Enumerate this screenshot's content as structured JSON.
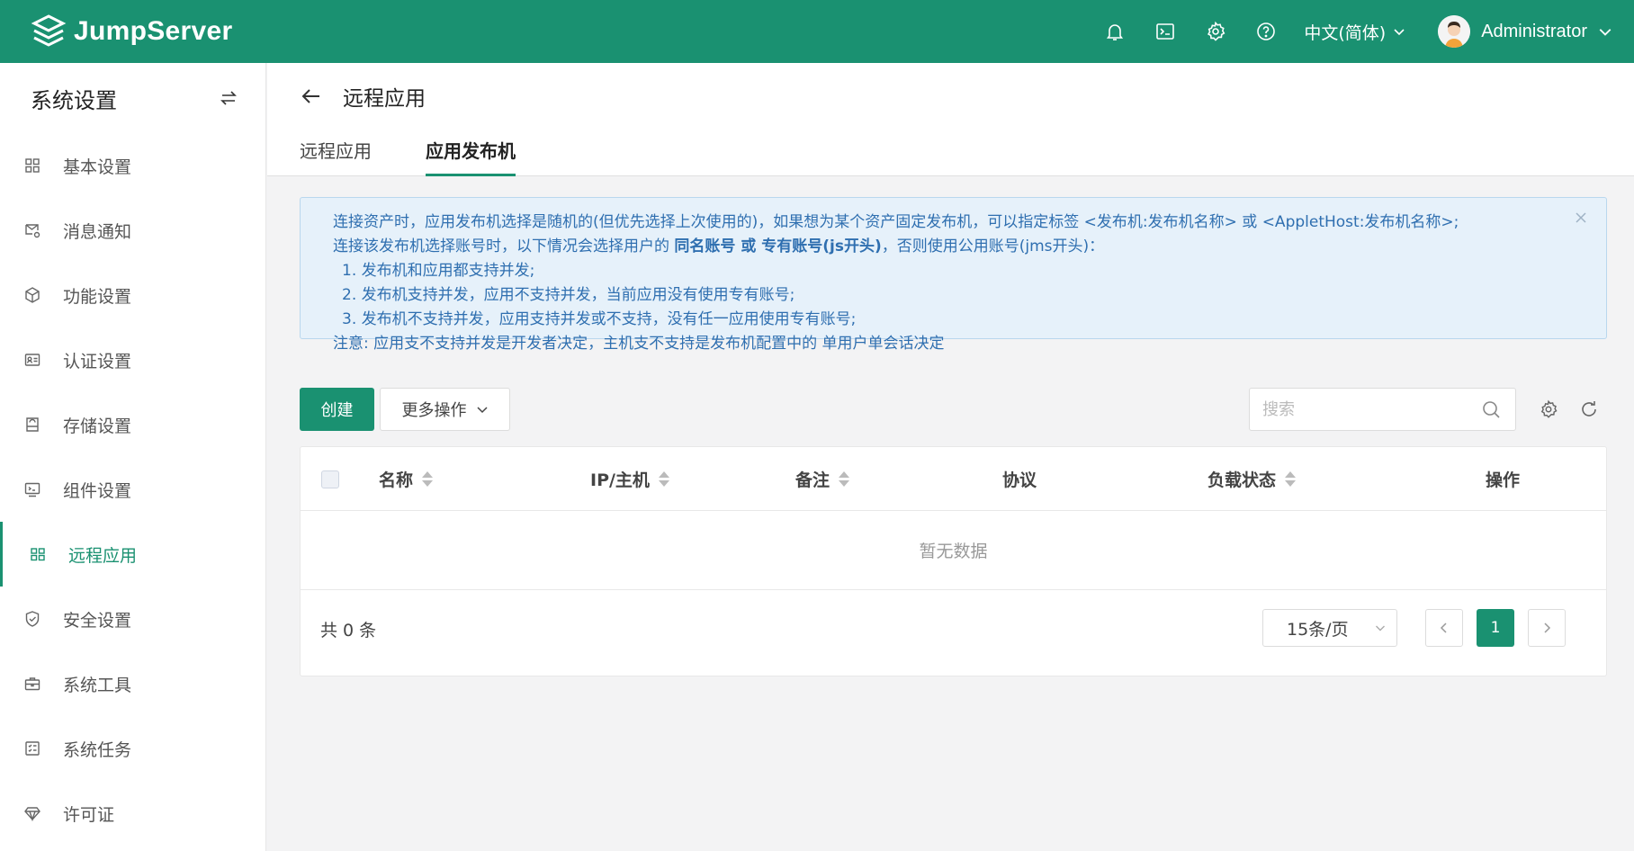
{
  "brand": {
    "name": "JumpServer",
    "color": "#1a9171"
  },
  "header": {
    "icons": [
      "bell-icon",
      "terminal-icon",
      "gear-icon",
      "help-icon"
    ],
    "language": "中文(简体)",
    "user": "Administrator"
  },
  "sidebar": {
    "title": "系统设置",
    "items": [
      {
        "label": "基本设置",
        "icon": "grid-icon"
      },
      {
        "label": "消息通知",
        "icon": "message-settings-icon"
      },
      {
        "label": "功能设置",
        "icon": "cube-icon"
      },
      {
        "label": "认证设置",
        "icon": "id-card-icon"
      },
      {
        "label": "存储设置",
        "icon": "storage-icon"
      },
      {
        "label": "组件设置",
        "icon": "monitor-terminal-icon"
      },
      {
        "label": "远程应用",
        "icon": "apps-icon",
        "active": true
      },
      {
        "label": "安全设置",
        "icon": "shield-check-icon"
      },
      {
        "label": "系统工具",
        "icon": "toolbox-icon"
      },
      {
        "label": "系统任务",
        "icon": "task-list-icon"
      },
      {
        "label": "许可证",
        "icon": "diamond-icon"
      }
    ]
  },
  "page": {
    "title": "远程应用",
    "tabs": [
      {
        "label": "远程应用"
      },
      {
        "label": "应用发布机",
        "active": true
      }
    ]
  },
  "alert": {
    "line1": "连接资产时，应用发布机选择是随机的(但优先选择上次使用的)，如果想为某个资产固定发布机，可以指定标签 <发布机:发布机名称> 或 <AppletHost:发布机名称>;",
    "line2_pre": "连接该发布机选择账号时，以下情况会选择用户的 ",
    "line2_bold": "同名账号 或 专有账号(js开头)",
    "line2_post": "，否则使用公用账号(jms开头)：",
    "item1": "1. 发布机和应用都支持并发;",
    "item2": "2. 发布机支持并发，应用不支持并发，当前应用没有使用专有账号;",
    "item3": "3. 发布机不支持并发，应用支持并发或不支持，没有任一应用使用专有账号;",
    "note": "注意: 应用支不支持并发是开发者决定，主机支不支持是发布机配置中的 单用户单会话决定"
  },
  "toolbar": {
    "create_label": "创建",
    "more_label": "更多操作",
    "search_placeholder": "搜索"
  },
  "table": {
    "columns": [
      {
        "label": "名称",
        "sortable": true
      },
      {
        "label": "IP/主机",
        "sortable": true
      },
      {
        "label": "备注",
        "sortable": true
      },
      {
        "label": "协议",
        "sortable": false
      },
      {
        "label": "负载状态",
        "sortable": true
      },
      {
        "label": "操作",
        "sortable": false
      }
    ],
    "empty_text": "暂无数据"
  },
  "pagination": {
    "total_text": "共 0 条",
    "page_size": "15条/页",
    "current_page": "1"
  }
}
